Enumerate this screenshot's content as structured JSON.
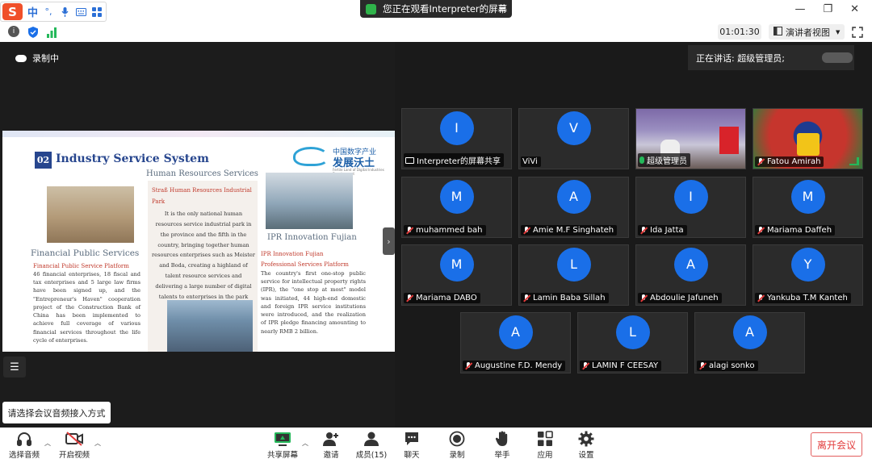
{
  "ime": {
    "logo": "S",
    "mode": "中",
    "punct": "°,"
  },
  "banner": {
    "text": "您正在观看Interpreter的屏幕"
  },
  "toolbar2": {
    "timer": "01:01:30",
    "view_mode": "演讲者视图"
  },
  "share": {
    "recording": "录制中",
    "audio_tip": "请选择会议音频接入方式",
    "slide": {
      "number": "02",
      "title": "Industry Service System",
      "logo_cn_small": "中国数字产业",
      "logo_cn_big": "发展沃土",
      "logo_en": "Fertile Land of Digital Industries Development",
      "hr_title": "Human Resources Services",
      "hr_sub1": "Straß Human Resources Industrial",
      "hr_sub2": "Park",
      "hr_body": "It is the only national human resources service industrial park in the province and the fifth in the country, bringing together human resources enterprises such as Meister and Boda, creating a highland of talent resource services and delivering a large number of digital talents to enterprises in the park",
      "fin_title": "Financial Public Services",
      "fin_sub": "Financial Public Service Platform",
      "fin_body": "46 financial enterprises, 18 fiscal and tax enterprises and 5 large law firms have been signed up, and the \"Entrepreneur's Haven\" cooperation project of the Construction Bank of China has been implemented to achieve full coverage of various financial services throughout the life cycle of enterprises.",
      "ipr_title": "IPR Innovation Fujian",
      "ipr_sub1": "IPR Innovation Fujian",
      "ipr_sub2": "Professional Services Platform",
      "ipr_body": "The country's first one-stop public service for intellectual property rights (IPR), the \"one stop at most\" model was initiated, 44 high-end domestic and foreign IPR service institutions were introduced, and the realization of IPR pledge financing amounting to nearly RMB 2 billion."
    }
  },
  "speaking": {
    "label": "正在讲话: 超级管理员;"
  },
  "participants": [
    {
      "initial": "I",
      "name": "Interpreter的屏幕共享",
      "icon": "share"
    },
    {
      "initial": "V",
      "name": "ViVi",
      "icon": "none"
    },
    {
      "initial": "",
      "name": "超级管理员",
      "icon": "mic-on"
    },
    {
      "initial": "",
      "name": "Fatou Amirah",
      "icon": "mic-off"
    },
    {
      "initial": "M",
      "name": "muhammed bah",
      "icon": "mic-off"
    },
    {
      "initial": "A",
      "name": "Amie M.F Singhateh",
      "icon": "mic-off"
    },
    {
      "initial": "I",
      "name": "Ida Jatta",
      "icon": "mic-off"
    },
    {
      "initial": "M",
      "name": "Mariama Daffeh",
      "icon": "mic-off"
    },
    {
      "initial": "M",
      "name": "Mariama DABO",
      "icon": "mic-off"
    },
    {
      "initial": "L",
      "name": "Lamin Baba Sillah",
      "icon": "mic-off"
    },
    {
      "initial": "A",
      "name": "Abdoulie Jafuneh",
      "icon": "mic-off"
    },
    {
      "initial": "Y",
      "name": "Yankuba T.M Kanteh",
      "icon": "mic-off"
    },
    {
      "initial": "A",
      "name": "Augustine F.D. Mendy",
      "icon": "mic-off"
    },
    {
      "initial": "L",
      "name": "LAMIN F CEESAY",
      "icon": "mic-off"
    },
    {
      "initial": "A",
      "name": "alagi sonko",
      "icon": "mic-off"
    }
  ],
  "bottombar": {
    "audio": "选择音频",
    "video": "开启视频",
    "share": "共享屏幕",
    "invite": "邀请",
    "members": "成员(15)",
    "chat": "聊天",
    "record": "录制",
    "raise": "举手",
    "apps": "应用",
    "settings": "设置",
    "leave": "离开会议"
  },
  "colors": {
    "avatar": "#1a6fe8",
    "leave": "#e23b3b",
    "mic_on": "#24b85a"
  }
}
